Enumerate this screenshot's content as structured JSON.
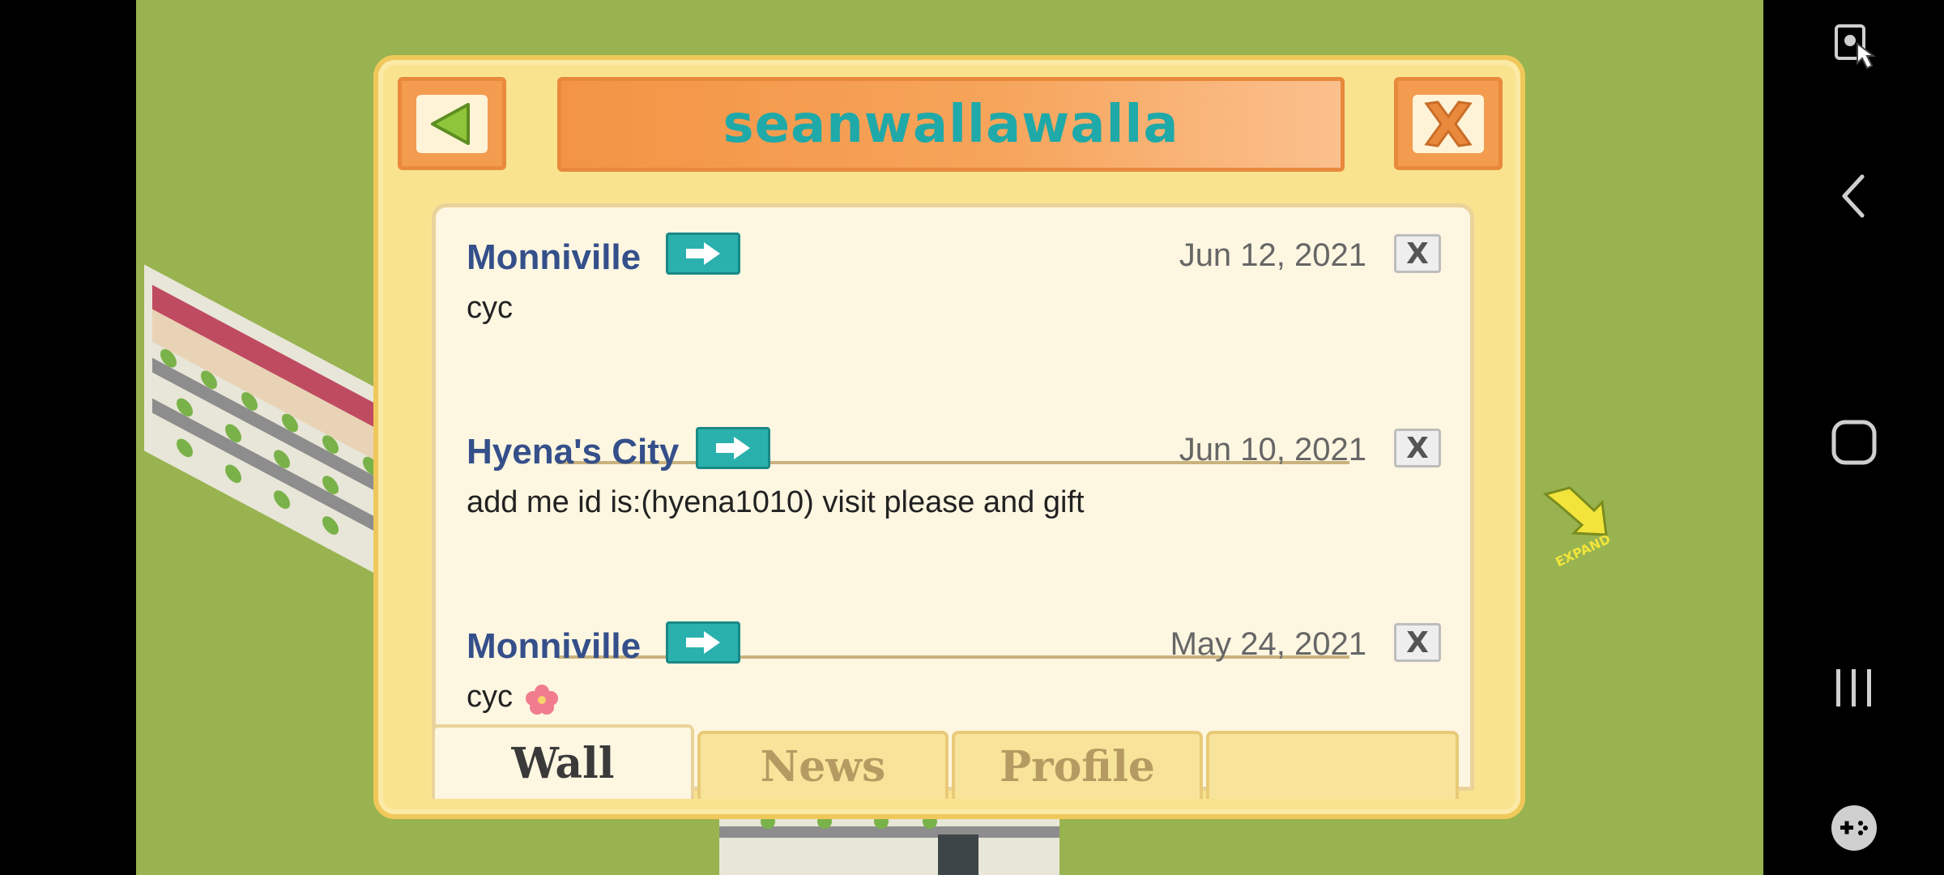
{
  "window": {
    "title": "seanwallawalla"
  },
  "posts": [
    {
      "author": "Monniville",
      "date": "Jun 12, 2021",
      "message": "cyc"
    },
    {
      "author": "Hyena's City",
      "date": "Jun 10, 2021",
      "message": "add me id is:(hyena1010) visit please and gift"
    },
    {
      "author": "Monniville",
      "date": "May 24, 2021",
      "message": "cyc"
    }
  ],
  "tabs": [
    {
      "label": "Wall",
      "active": true
    },
    {
      "label": "News",
      "active": false
    },
    {
      "label": "Profile",
      "active": false
    }
  ],
  "map": {
    "expand_label": "EXPAND"
  },
  "colors": {
    "title": "#1fa9a8",
    "author": "#344f8a",
    "accent_orange": "#f39c4f",
    "go_button": "#2ab1ad"
  },
  "icons": {
    "back": "back-arrow-icon",
    "close": "close-icon",
    "go": "arrow-right-icon",
    "delete": "delete-x-icon"
  }
}
